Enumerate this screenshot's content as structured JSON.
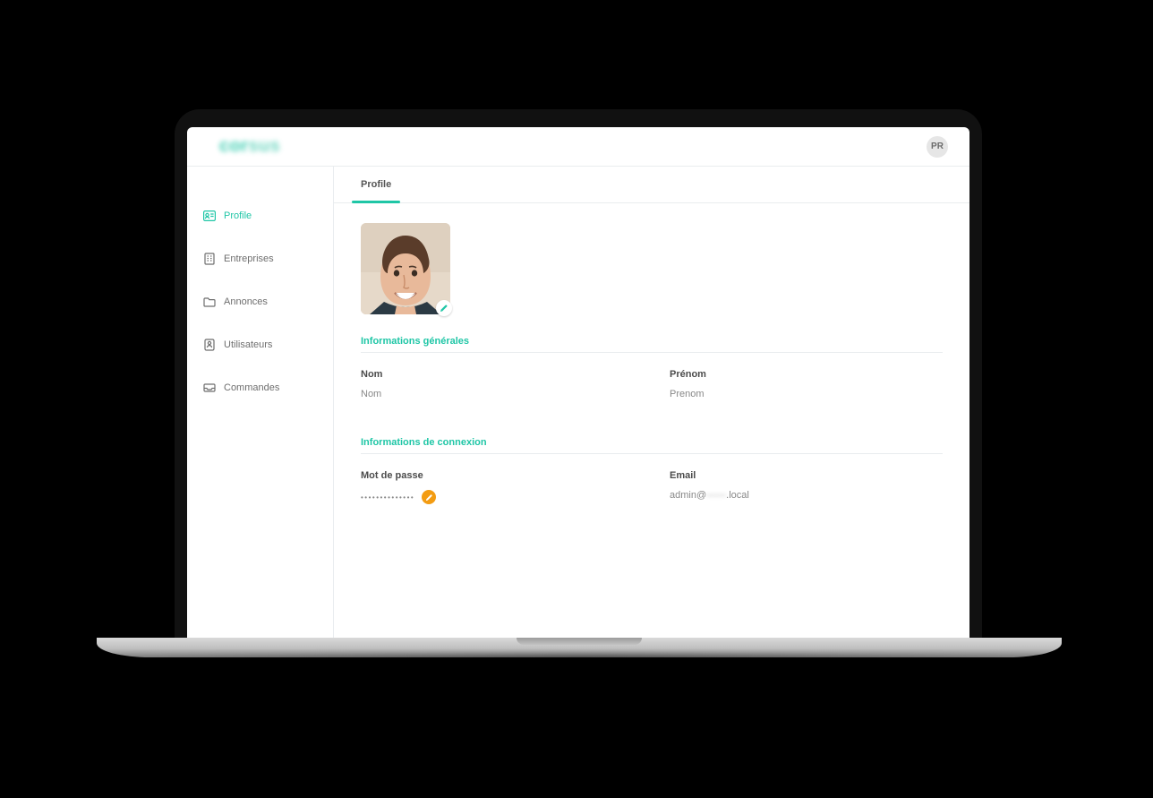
{
  "header": {
    "avatar_initials": "PR"
  },
  "sidebar": {
    "items": [
      {
        "label": "Profile"
      },
      {
        "label": "Entreprises"
      },
      {
        "label": "Annonces"
      },
      {
        "label": "Utilisateurs"
      },
      {
        "label": "Commandes"
      }
    ]
  },
  "tabs": {
    "profile": "Profile"
  },
  "sections": {
    "general": "Informations générales",
    "connection": "Informations de connexion"
  },
  "fields": {
    "nom_label": "Nom",
    "nom_value": "Nom",
    "prenom_label": "Prénom",
    "prenom_value": "Prenom",
    "password_label": "Mot de passe",
    "password_value": "••••••••••••••",
    "email_label": "Email",
    "email_prefix": "admin@",
    "email_obscured": "——",
    "email_suffix": ".local"
  }
}
